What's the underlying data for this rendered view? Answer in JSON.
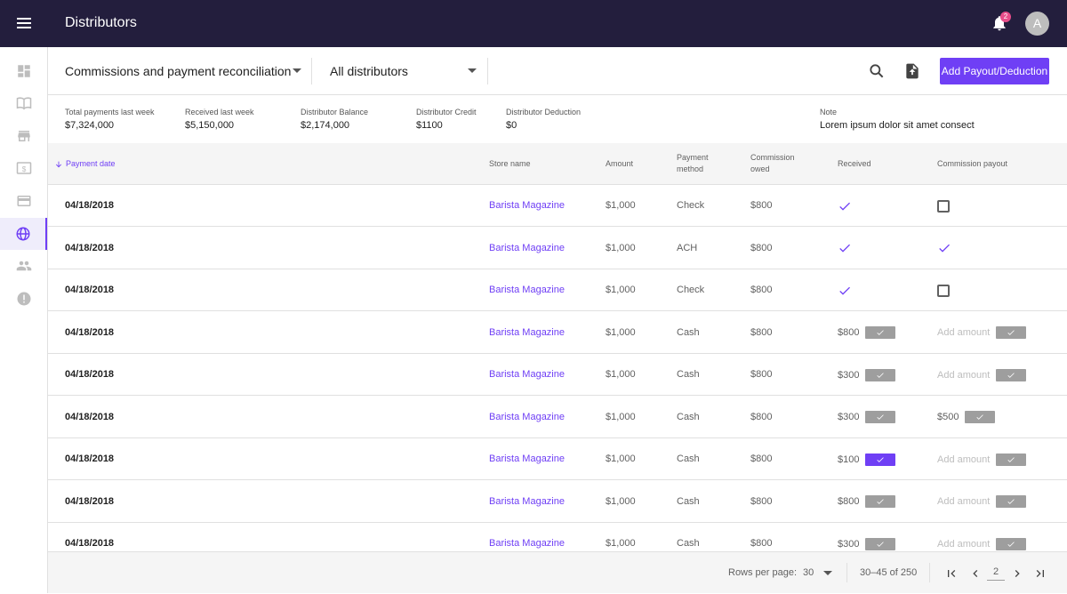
{
  "app": {
    "title": "Distributors",
    "notification_count": "2",
    "avatar_initial": "A"
  },
  "sidebar": {
    "items": [
      {
        "icon": "dashboard-icon"
      },
      {
        "icon": "book-icon"
      },
      {
        "icon": "store-icon"
      },
      {
        "icon": "dollar-icon"
      },
      {
        "icon": "credit-card-icon"
      },
      {
        "icon": "globe-icon",
        "active": true
      },
      {
        "icon": "people-icon"
      },
      {
        "icon": "alert-icon"
      }
    ]
  },
  "toolbar": {
    "view_select": "Commissions and payment reconciliation",
    "distributor_select": "All distributors",
    "add_button": "Add Payout/Deduction"
  },
  "summary": {
    "total_payments_label": "Total payments last week",
    "total_payments_value": "$7,324,000",
    "received_label": "Received last week",
    "received_value": "$5,150,000",
    "balance_label": "Distributor Balance",
    "balance_value": "$2,174,000",
    "credit_label": "Distributor Credit",
    "credit_value": "$1100",
    "deduction_label": "Distributor Deduction",
    "deduction_value": "$0",
    "note_label": "Note",
    "note_value": "Lorem ipsum dolor sit amet consect"
  },
  "table": {
    "headers": {
      "date": "Payment date",
      "store": "Store name",
      "amount": "Amount",
      "method_1": "Payment",
      "method_2": "method",
      "owed_1": "Commission",
      "owed_2": "owed",
      "received": "Received",
      "payout": "Commission payout"
    },
    "placeholder_add_amount": "Add amount",
    "rows": [
      {
        "date": "04/18/2018",
        "store": "Barista Magazine",
        "amount": "$1,000",
        "method": "Check",
        "owed": "$800",
        "received": "",
        "received_mode": "check",
        "payout": "",
        "payout_mode": "checkbox"
      },
      {
        "date": "04/18/2018",
        "store": "Barista Magazine",
        "amount": "$1,000",
        "method": "ACH",
        "owed": "$800",
        "received": "",
        "received_mode": "check",
        "payout": "",
        "payout_mode": "check"
      },
      {
        "date": "04/18/2018",
        "store": "Barista Magazine",
        "amount": "$1,000",
        "method": "Check",
        "owed": "$800",
        "received": "",
        "received_mode": "check",
        "payout": "",
        "payout_mode": "checkbox"
      },
      {
        "date": "04/18/2018",
        "store": "Barista Magazine",
        "amount": "$1,000",
        "method": "Cash",
        "owed": "$800",
        "received": "$800",
        "received_mode": "input",
        "payout": "Add amount",
        "payout_mode": "placeholder"
      },
      {
        "date": "04/18/2018",
        "store": "Barista Magazine",
        "amount": "$1,000",
        "method": "Cash",
        "owed": "$800",
        "received": "$300",
        "received_mode": "input",
        "payout": "Add amount",
        "payout_mode": "placeholder"
      },
      {
        "date": "04/18/2018",
        "store": "Barista Magazine",
        "amount": "$1,000",
        "method": "Cash",
        "owed": "$800",
        "received": "$300",
        "received_mode": "input",
        "payout": "$500",
        "payout_mode": "input"
      },
      {
        "date": "04/18/2018",
        "store": "Barista Magazine",
        "amount": "$1,000",
        "method": "Cash",
        "owed": "$800",
        "received": "$100",
        "received_mode": "input-active",
        "payout": "Add amount",
        "payout_mode": "placeholder"
      },
      {
        "date": "04/18/2018",
        "store": "Barista Magazine",
        "amount": "$1,000",
        "method": "Cash",
        "owed": "$800",
        "received": "$800",
        "received_mode": "input",
        "payout": "Add amount",
        "payout_mode": "placeholder"
      },
      {
        "date": "04/18/2018",
        "store": "Barista Magazine",
        "amount": "$1,000",
        "method": "Cash",
        "owed": "$800",
        "received": "$300",
        "received_mode": "input",
        "payout": "Add amount",
        "payout_mode": "placeholder"
      }
    ]
  },
  "pagination": {
    "rows_per_page_label": "Rows per page:",
    "rows_per_page_value": "30",
    "range": "30–45 of 250",
    "page": "2"
  },
  "colors": {
    "accent": "#6f3ff5",
    "appbar": "#231e3d",
    "badge": "#e84d8a"
  }
}
